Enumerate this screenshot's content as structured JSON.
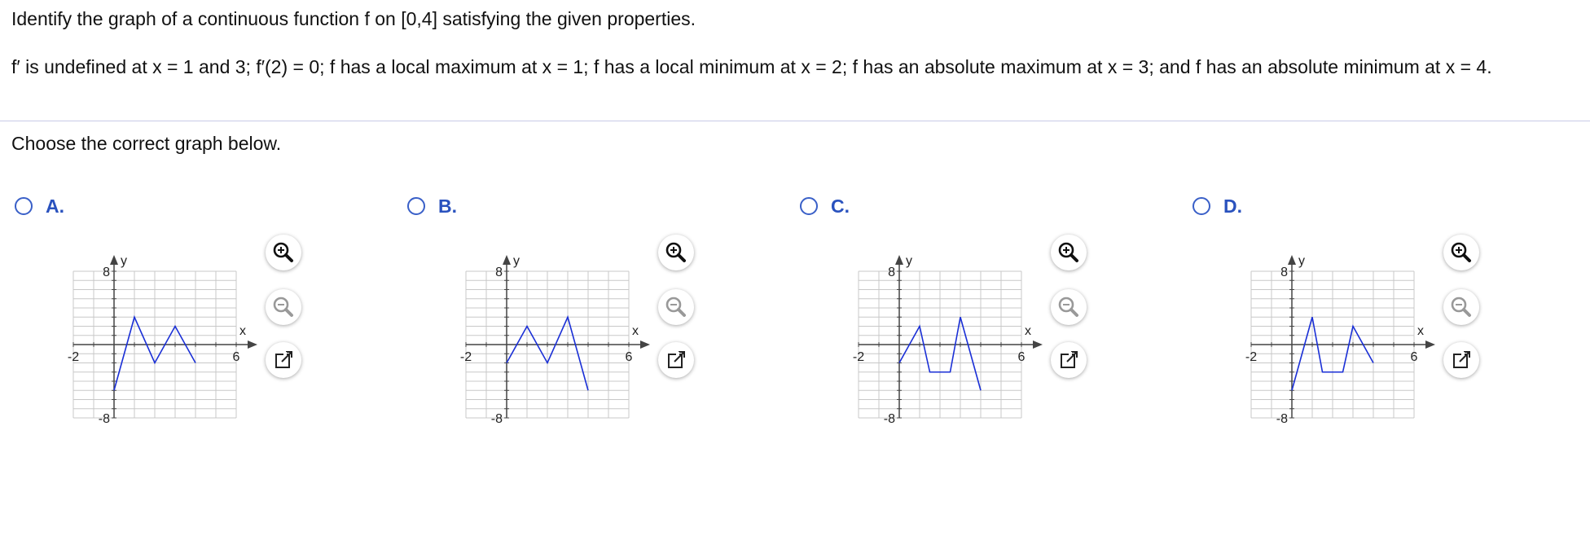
{
  "question": {
    "prompt": "Identify the graph of a continuous function f on [0,4] satisfying the given properties.",
    "properties": "f′ is undefined at x = 1 and 3; f′(2) = 0; f has a local maximum at x = 1; f has a local minimum at x = 2; f has an absolute maximum at x = 3; and f has an absolute minimum at x = 4.",
    "instruction": "Choose the correct graph below."
  },
  "axis_labels": {
    "x_label": "x",
    "y_label": "y",
    "x_min_tick": "-2",
    "x_max_tick": "6",
    "y_max_tick": "8",
    "y_min_tick": "-8"
  },
  "colors": {
    "accent": "#2a52be",
    "curve": "#1a2fd6",
    "grid": "#c8c8c8",
    "axis": "#444444"
  },
  "icons": {
    "zoom_in": "zoom-in-icon",
    "zoom_out": "zoom-out-icon",
    "popout": "open-external-icon"
  },
  "choices": [
    {
      "label": "A.",
      "selected": false,
      "points": [
        [
          0,
          -5
        ],
        [
          1,
          3
        ],
        [
          2,
          -2
        ],
        [
          3,
          2
        ],
        [
          4,
          -2
        ]
      ]
    },
    {
      "label": "B.",
      "selected": false,
      "points": [
        [
          0,
          -2
        ],
        [
          1,
          2
        ],
        [
          2,
          -2
        ],
        [
          3,
          3
        ],
        [
          4,
          -5
        ]
      ]
    },
    {
      "label": "C.",
      "selected": false,
      "points": [
        [
          0,
          -2
        ],
        [
          1,
          2
        ],
        [
          1.5,
          -3
        ],
        [
          2.5,
          -3
        ],
        [
          3,
          3
        ],
        [
          4,
          -5
        ]
      ]
    },
    {
      "label": "D.",
      "selected": false,
      "points": [
        [
          0,
          -5
        ],
        [
          1,
          3
        ],
        [
          1.5,
          -3
        ],
        [
          2.5,
          -3
        ],
        [
          3,
          2
        ],
        [
          4,
          -2
        ]
      ]
    }
  ],
  "chart_data": [
    {
      "type": "line",
      "x": [
        0,
        1,
        2,
        3,
        4
      ],
      "y": [
        -5,
        3,
        -2,
        2,
        -2
      ],
      "xlim": [
        -2,
        6
      ],
      "ylim": [
        -8,
        8
      ],
      "xlabel": "x",
      "ylabel": "y"
    },
    {
      "type": "line",
      "x": [
        0,
        1,
        2,
        3,
        4
      ],
      "y": [
        -2,
        2,
        -2,
        3,
        -5
      ],
      "xlim": [
        -2,
        6
      ],
      "ylim": [
        -8,
        8
      ],
      "xlabel": "x",
      "ylabel": "y"
    },
    {
      "type": "line",
      "x": [
        0,
        1,
        1.5,
        2.5,
        3,
        4
      ],
      "y": [
        -2,
        2,
        -3,
        -3,
        3,
        -5
      ],
      "xlim": [
        -2,
        6
      ],
      "ylim": [
        -8,
        8
      ],
      "xlabel": "x",
      "ylabel": "y"
    },
    {
      "type": "line",
      "x": [
        0,
        1,
        1.5,
        2.5,
        3,
        4
      ],
      "y": [
        -5,
        3,
        -3,
        -3,
        2,
        -2
      ],
      "xlim": [
        -2,
        6
      ],
      "ylim": [
        -8,
        8
      ],
      "xlabel": "x",
      "ylabel": "y"
    }
  ]
}
